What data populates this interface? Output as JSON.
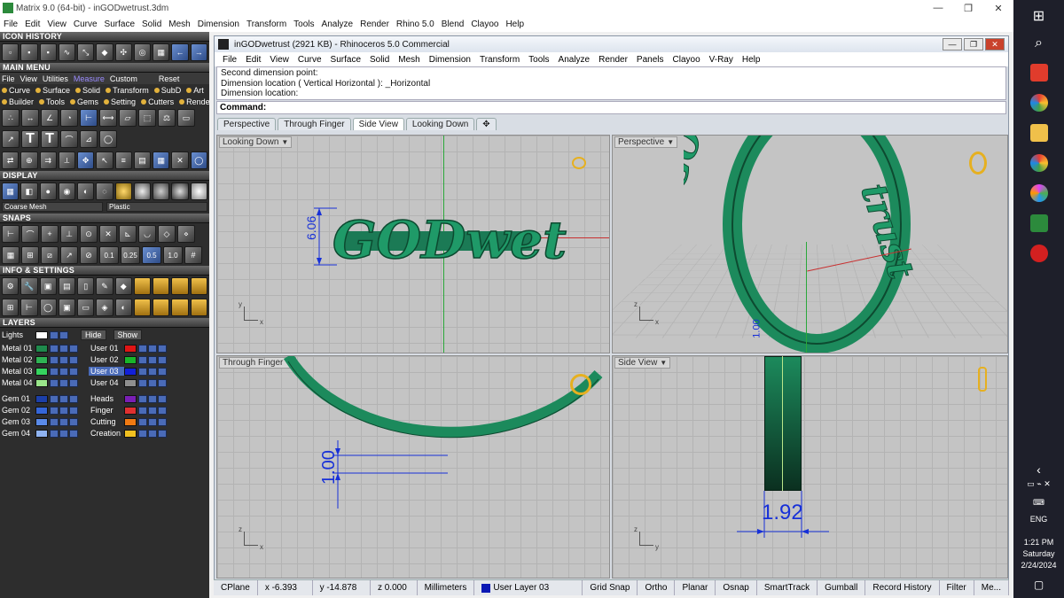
{
  "outer": {
    "title": "Matrix 9.0 (64-bit) - inGODwetrust.3dm",
    "menu": [
      "File",
      "Edit",
      "View",
      "Curve",
      "Surface",
      "Solid",
      "Mesh",
      "Dimension",
      "Transform",
      "Tools",
      "Analyze",
      "Render",
      "Rhino 5.0",
      "Blend",
      "Clayoo",
      "Help"
    ]
  },
  "left": {
    "icon_history": "ICON HISTORY",
    "main_menu": "MAIN MENU",
    "mm_row1": [
      "File",
      "View",
      "Utilities",
      "Measure",
      "Custom",
      "Reset"
    ],
    "mm_row2": [
      "Curve",
      "Surface",
      "Solid",
      "Transform",
      "SubD",
      "Art"
    ],
    "mm_row3": [
      "Builder",
      "Tools",
      "Gems",
      "Setting",
      "Cutters",
      "Render"
    ],
    "display": "DISPLAY",
    "display_mesh": "Coarse Mesh",
    "display_material": "Plastic",
    "snaps": "SNAPS",
    "snap_values": [
      "0.1",
      "0.25",
      "0.5",
      "1.0"
    ],
    "info_settings": "INFO & SETTINGS",
    "layers": "LAYERS",
    "lights": "Lights",
    "hide": "Hide",
    "show": "Show",
    "layer_left": [
      {
        "name": "Metal 01",
        "color": "#1f8a4c"
      },
      {
        "name": "Metal 02",
        "color": "#2fb354"
      },
      {
        "name": "Metal 03",
        "color": "#35d35e"
      },
      {
        "name": "Metal 04",
        "color": "#9ae68a"
      },
      {
        "name": "Gem 01",
        "color": "#1c3fa8"
      },
      {
        "name": "Gem 02",
        "color": "#3566d8"
      },
      {
        "name": "Gem 03",
        "color": "#5a8ae8"
      },
      {
        "name": "Gem 04",
        "color": "#8fb3f0"
      }
    ],
    "layer_right": [
      {
        "name": "User 01",
        "color": "#e01515"
      },
      {
        "name": "User 02",
        "color": "#19b52a"
      },
      {
        "name": "User 03",
        "color": "#1320d8"
      },
      {
        "name": "User 04",
        "color": "#8f8f8f"
      },
      {
        "name": "Heads",
        "color": "#7a1fb5"
      },
      {
        "name": "Finger",
        "color": "#e03030"
      },
      {
        "name": "Cutting",
        "color": "#f07a12"
      },
      {
        "name": "Creation",
        "color": "#f0c020"
      }
    ]
  },
  "rhino": {
    "title": "inGODwetrust (2921 KB) - Rhinoceros 5.0 Commercial",
    "menu": [
      "File",
      "Edit",
      "View",
      "Curve",
      "Surface",
      "Solid",
      "Mesh",
      "Dimension",
      "Transform",
      "Tools",
      "Analyze",
      "Render",
      "Panels",
      "Clayoo",
      "V-Ray",
      "Help"
    ],
    "history": [
      "Second dimension point:",
      "Dimension location ( Vertical  Horizontal ): _Horizontal",
      "Dimension location:"
    ],
    "command_label": "Command:",
    "command_value": "",
    "tabs": [
      "Perspective",
      "Through Finger",
      "Side View",
      "Looking Down"
    ],
    "active_tab": "Side View",
    "viewports": {
      "top_left": "Looking Down",
      "top_right": "Perspective",
      "bottom_left": "Through Finger",
      "bottom_right": "Side View"
    },
    "model_text": "GODwetr",
    "dims": {
      "height": "6.06",
      "thickness": "1.00",
      "width": "1.92",
      "persp": "1.00"
    },
    "status": {
      "cplane": "CPlane",
      "x": "x -6.393",
      "y": "y -14.878",
      "z": "z 0.000",
      "units": "Millimeters",
      "layer": "User Layer 03",
      "toggles": [
        "Grid Snap",
        "Ortho",
        "Planar",
        "Osnap",
        "SmartTrack",
        "Gumball",
        "Record History",
        "Filter",
        "Me..."
      ]
    }
  },
  "taskbar": {
    "time": "1:21 PM",
    "day": "Saturday",
    "date": "2/24/2024",
    "lang": "ENG"
  },
  "colors": {
    "model": "#1c8a5c",
    "dim": "#1730d8",
    "gold": "#e6b020"
  }
}
